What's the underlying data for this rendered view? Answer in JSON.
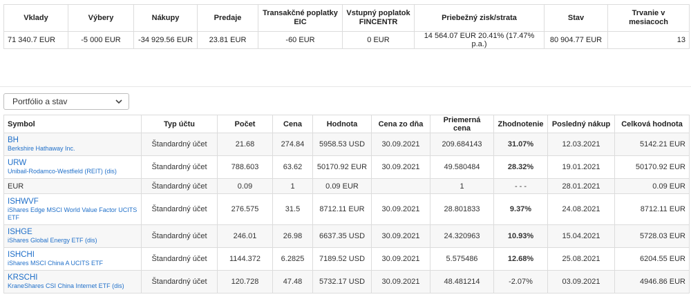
{
  "summary": {
    "headers": [
      "Vklady",
      "Výbery",
      "Nákupy",
      "Predaje",
      "Transakčné poplatky EIC",
      "Vstupný poplatok FINCENTR",
      "Priebežný zisk/strata",
      "Stav",
      "Trvanie v mesiacoch"
    ],
    "values": [
      "71 340.7 EUR",
      "-5 000 EUR",
      "-34 929.56 EUR",
      "23.81 EUR",
      "-60 EUR",
      "0 EUR",
      "14 564.07 EUR 20.41% (17.47% p.a.)",
      "80 904.77 EUR",
      "13"
    ]
  },
  "view_select": {
    "label": "Portfólio a stav"
  },
  "portfolio": {
    "headers": [
      "Symbol",
      "Typ účtu",
      "Počet",
      "Cena",
      "Hodnota",
      "Cena zo dňa",
      "Priemerná cena",
      "Zhodnotenie",
      "Posledný nákup",
      "Celková hodnota"
    ],
    "rows": [
      {
        "ticker": "BH",
        "name": "Berkshire Hathaway Inc.",
        "account": "Štandardný účet",
        "count": "21.68",
        "price": "274.84",
        "value": "5958.53 USD",
        "price_date": "30.09.2021",
        "avg_price": "209.684143",
        "gain": "31.07%",
        "gain_class": "pos",
        "last_buy": "12.03.2021",
        "total": "5142.21 EUR"
      },
      {
        "ticker": "URW",
        "name": "Unibail-Rodamco-Westfield (REIT) (dis)",
        "account": "Štandardný účet",
        "count": "788.603",
        "price": "63.62",
        "value": "50170.92 EUR",
        "price_date": "30.09.2021",
        "avg_price": "49.580484",
        "gain": "28.32%",
        "gain_class": "pos",
        "last_buy": "19.01.2021",
        "total": "50170.92 EUR"
      },
      {
        "ticker": "",
        "plain": "EUR",
        "name": "",
        "account": "Štandardný účet",
        "count": "0.09",
        "price": "1",
        "value": "0.09 EUR",
        "price_date": "",
        "avg_price": "1",
        "gain": "- - -",
        "gain_class": "neu",
        "last_buy": "28.01.2021",
        "total": "0.09 EUR"
      },
      {
        "ticker": "ISHWVF",
        "name": "iShares Edge MSCI World Value Factor UCITS ETF",
        "account": "Štandardný účet",
        "count": "276.575",
        "price": "31.5",
        "value": "8712.11 EUR",
        "price_date": "30.09.2021",
        "avg_price": "28.801833",
        "gain": "9.37%",
        "gain_class": "pos",
        "last_buy": "24.08.2021",
        "total": "8712.11 EUR"
      },
      {
        "ticker": "ISHGE",
        "name": "iShares Global Energy ETF (dis)",
        "account": "Štandardný účet",
        "count": "246.01",
        "price": "26.98",
        "value": "6637.35 USD",
        "price_date": "30.09.2021",
        "avg_price": "24.320963",
        "gain": "10.93%",
        "gain_class": "pos",
        "last_buy": "15.04.2021",
        "total": "5728.03 EUR"
      },
      {
        "ticker": "ISHCHI",
        "name": "iShares MSCI China A UCITS ETF",
        "account": "Štandardný účet",
        "count": "1144.372",
        "price": "6.2825",
        "value": "7189.52 USD",
        "price_date": "30.09.2021",
        "avg_price": "5.575486",
        "gain": "12.68%",
        "gain_class": "pos",
        "last_buy": "25.08.2021",
        "total": "6204.55 EUR"
      },
      {
        "ticker": "KRSCHI",
        "name": "KraneShares CSI China Internet ETF (dis)",
        "account": "Štandardný účet",
        "count": "120.728",
        "price": "47.48",
        "value": "5732.17 USD",
        "price_date": "30.09.2021",
        "avg_price": "48.481214",
        "gain": "-2.07%",
        "gain_class": "neg",
        "last_buy": "03.09.2021",
        "total": "4946.86 EUR"
      }
    ]
  }
}
